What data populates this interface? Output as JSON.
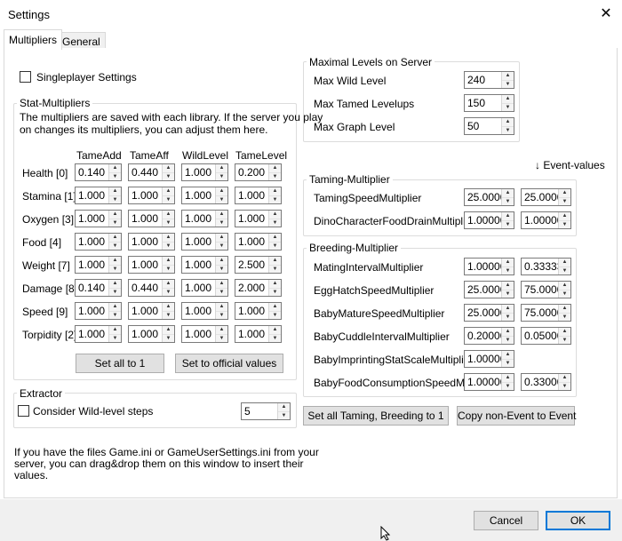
{
  "window": {
    "title": "Settings",
    "close_glyph": "✕"
  },
  "tabs": [
    {
      "label": "Multipliers",
      "active": true
    },
    {
      "label": "General",
      "active": false
    }
  ],
  "singleplayer_label": "Singleplayer Settings",
  "stat_multipliers": {
    "legend": "Stat-Multipliers",
    "description_line1": "The multipliers are saved with each library. If the server you play",
    "description_line2": "on changes its multipliers, you can adjust them here.",
    "columns": [
      "TameAdd",
      "TameAff",
      "WildLevel",
      "TameLevel"
    ],
    "rows": [
      {
        "label": "Health [0]",
        "values": [
          "0.140",
          "0.440",
          "1.000",
          "0.200"
        ]
      },
      {
        "label": "Stamina [1]",
        "values": [
          "1.000",
          "1.000",
          "1.000",
          "1.000"
        ]
      },
      {
        "label": "Oxygen [3]",
        "values": [
          "1.000",
          "1.000",
          "1.000",
          "1.000"
        ]
      },
      {
        "label": "Food [4]",
        "values": [
          "1.000",
          "1.000",
          "1.000",
          "1.000"
        ]
      },
      {
        "label": "Weight [7]",
        "values": [
          "1.000",
          "1.000",
          "1.000",
          "2.500"
        ]
      },
      {
        "label": "Damage [8]",
        "values": [
          "0.140",
          "0.440",
          "1.000",
          "2.000"
        ]
      },
      {
        "label": "Speed [9]",
        "values": [
          "1.000",
          "1.000",
          "1.000",
          "1.000"
        ]
      },
      {
        "label": "Torpidity [2]",
        "values": [
          "1.000",
          "1.000",
          "1.000",
          "1.000"
        ]
      }
    ],
    "set_all_label": "Set all to 1",
    "set_official_label": "Set to official values"
  },
  "extractor": {
    "legend": "Extractor",
    "consider_label": "Consider Wild-level steps",
    "steps_value": "5"
  },
  "drag_hint_line1": "If you have the files Game.ini or GameUserSettings.ini from your",
  "drag_hint_line2": "server, you can drag&drop them on this window to insert their",
  "drag_hint_line3": "values.",
  "max_levels": {
    "legend": "Maximal Levels on Server",
    "rows": [
      {
        "label": "Max Wild Level",
        "value": "240"
      },
      {
        "label": "Max Tamed Levelups",
        "value": "150"
      },
      {
        "label": "Max Graph Level",
        "value": "50"
      }
    ]
  },
  "event_values_label": "↓ Event-values",
  "taming": {
    "legend": "Taming-Multiplier",
    "rows": [
      {
        "label": "TamingSpeedMultiplier",
        "value": "25.0000",
        "event": "25.0000"
      },
      {
        "label": "DinoCharacterFoodDrainMultiplier",
        "value": "1.00000",
        "event": "1.00000"
      }
    ]
  },
  "breeding": {
    "legend": "Breeding-Multiplier",
    "rows": [
      {
        "label": "MatingIntervalMultiplier",
        "value": "1.00000",
        "event": "0.33333"
      },
      {
        "label": "EggHatchSpeedMultiplier",
        "value": "25.0000",
        "event": "75.0000"
      },
      {
        "label": "BabyMatureSpeedMultiplier",
        "value": "25.0000",
        "event": "75.0000"
      },
      {
        "label": "BabyCuddleIntervalMultiplier",
        "value": "0.20000",
        "event": "0.05000"
      },
      {
        "label": "BabyImprintingStatScaleMultiplier",
        "value": "1.00000",
        "event": ""
      },
      {
        "label": "BabyFoodConsumptionSpeedMult",
        "value": "1.00000",
        "event": "0.33000"
      }
    ]
  },
  "set_all_taming_label": "Set all Taming, Breeding to 1",
  "copy_event_label": "Copy non-Event to Event",
  "cancel_label": "Cancel",
  "ok_label": "OK",
  "colors": {
    "accent": "#0078d7",
    "button_face": "#e1e1e1",
    "group_border": "#dcdcdc"
  }
}
